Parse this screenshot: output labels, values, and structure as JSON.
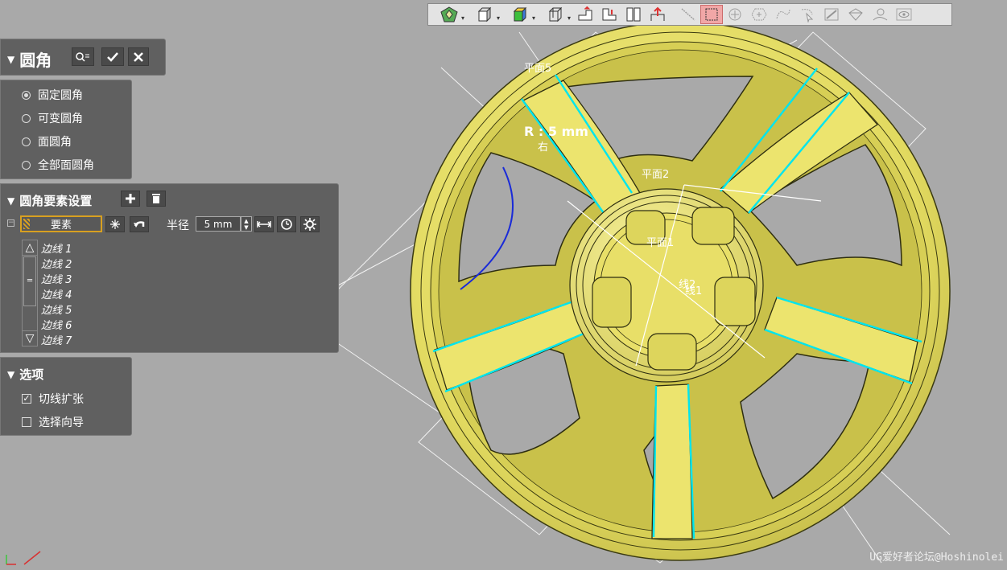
{
  "toolbar": {
    "icons": [
      "render-style-icon",
      "view-cube-icon",
      "shaded-icon",
      "orthographic-icon",
      "clip-plane-icon",
      "section-icon",
      "split-view-icon",
      "arrow-up-icon",
      "line-tool-icon",
      "select-box-icon",
      "snap-point-icon",
      "snap-hex-icon",
      "snap-curve-icon",
      "snap-cursor-icon",
      "measure-icon",
      "surface-icon",
      "shape-icon",
      "eye-icon"
    ]
  },
  "panel_title": {
    "title": "圆角",
    "buttons": [
      "preview-button",
      "confirm-button",
      "cancel-button"
    ]
  },
  "fillet_type": {
    "options": [
      {
        "label": "固定圆角",
        "selected": true
      },
      {
        "label": "可变圆角",
        "selected": false
      },
      {
        "label": "面圆角",
        "selected": false
      },
      {
        "label": "全部面圆角",
        "selected": false
      }
    ]
  },
  "settings": {
    "title": "圆角要素设置",
    "element_label": "要素",
    "radius_label": "半径",
    "radius_value": "5 mm",
    "edges": [
      "边线 1",
      "边线 2",
      "边线 3",
      "边线 4",
      "边线 5",
      "边线 6",
      "边线 7"
    ]
  },
  "options": {
    "title": "选项",
    "items": [
      {
        "label": "切线扩张",
        "checked": true
      },
      {
        "label": "选择向导",
        "checked": false
      }
    ]
  },
  "viewport": {
    "labels": {
      "plane5": "平面5",
      "plane2": "平面2",
      "plane1": "平面1",
      "right": "右",
      "line_label": "线1",
      "line_label2": "线2",
      "radius_callout": "R : 5 mm"
    },
    "colors": {
      "wheel": "#e8e06a",
      "edge_highlight": "#00e5ee",
      "background": "#a9a9a9"
    }
  },
  "watermark": "UG爱好者论坛@Hoshinolei"
}
